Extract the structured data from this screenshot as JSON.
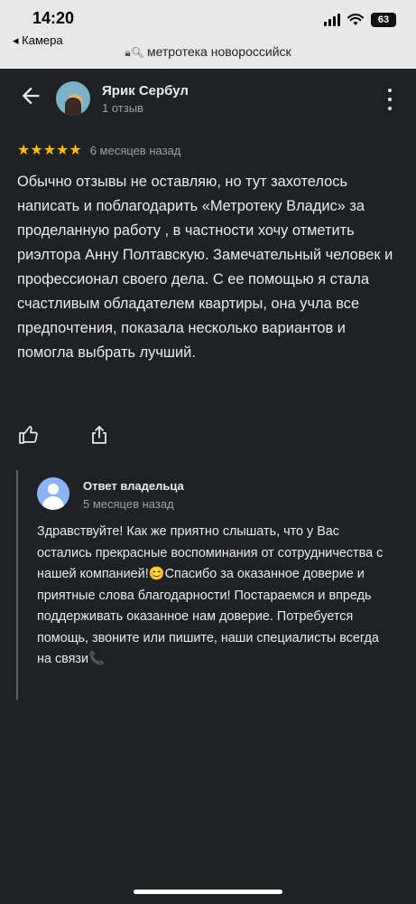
{
  "status_bar": {
    "time": "14:20",
    "back_app": "◂ Камера",
    "battery": "63"
  },
  "browser": {
    "url": "метротека новороссийск",
    "url_icons": "🔒︎🔍︎"
  },
  "review": {
    "author": "Ярик Сербул",
    "author_meta": "1 отзыв",
    "stars": "★★★★★",
    "rating_value": 5,
    "date": "6 месяцев назад",
    "text": "Обычно отзывы не оставляю, но тут захотелось написать и поблагодарить «Метротеку Владис» за проделанную работу , в частности хочу отметить риэлтора Анну Полтавскую. Замечательный человек и профессионал своего дела. С ее помощью я стала счастливым обладателем квартиры, она учла все предпочтения, показала несколько вариантов и помогла выбрать лучший."
  },
  "owner_reply": {
    "title": "Ответ владельца",
    "date": "5 месяцев назад",
    "text": "Здравствуйте! Как же приятно слышать, что у Вас остались прекрасные воспоминания от сотрудничества с нашей компанией!😊Спасибо за оказанное доверие и приятные слова благодарности! Постараемся и впредь поддерживать оказанное нам доверие. Потребуется помощь, звоните или пишите, наши специалисты всегда на связи📞"
  },
  "icons": {
    "back": "arrow-left-icon",
    "more": "more-vert-icon",
    "like": "thumb-up-icon",
    "share": "share-icon",
    "owner_avatar": "person-icon"
  },
  "colors": {
    "background": "#202124",
    "star": "#fbbc04",
    "owner_avatar": "#8ab4f8"
  }
}
